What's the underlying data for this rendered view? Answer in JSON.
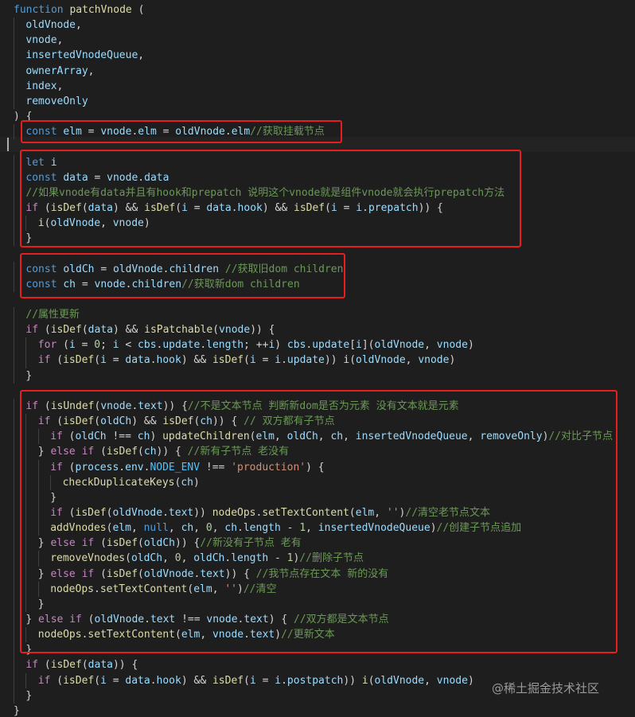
{
  "code_lines": [
    "function patchVnode (",
    "oldVnode,",
    "vnode,",
    "insertedVnodeQueue,",
    "ownerArray,",
    "index,",
    "removeOnly",
    ") {",
    "const elm = vnode.elm = oldVnode.elm//获取挂载节点",
    "",
    "let i",
    "const data = vnode.data",
    "//如果vnode有data并且有hook和prepatch 说明这个vnode就是组件vnode就会执行prepatch方法",
    "if (isDef(data) && isDef(i = data.hook) && isDef(i = i.prepatch)) {",
    "i(oldVnode, vnode)",
    "}",
    "",
    "const oldCh = oldVnode.children //获取旧dom children",
    "const ch = vnode.children//获取新dom children",
    "",
    "//属性更新",
    "if (isDef(data) && isPatchable(vnode)) {",
    "for (i = 0; i < cbs.update.length; ++i) cbs.update[i](oldVnode, vnode)",
    "if (isDef(i = data.hook) && isDef(i = i.update)) i(oldVnode, vnode)",
    "}",
    "",
    "if (isUndef(vnode.text)) {//不是文本节点 判断新dom是否为元素 没有文本就是元素",
    "if (isDef(oldCh) && isDef(ch)) { // 双方都有子节点",
    "if (oldCh !== ch) updateChildren(elm, oldCh, ch, insertedVnodeQueue, removeOnly)//对比子节点",
    "} else if (isDef(ch)) { //新有子节点 老没有",
    "if (process.env.NODE_ENV !== 'production') {",
    "checkDuplicateKeys(ch)",
    "}",
    "if (isDef(oldVnode.text)) nodeOps.setTextContent(elm, '')//清空老节点文本",
    "addVnodes(elm, null, ch, 0, ch.length - 1, insertedVnodeQueue)//创建子节点追加",
    "} else if (isDef(oldCh)) {//新没有子节点 老有",
    "removeVnodes(oldCh, 0, oldCh.length - 1)//删除子节点",
    "} else if (isDef(oldVnode.text)) { //我节点存在文本 新的没有",
    "nodeOps.setTextContent(elm, '')//清空",
    "}",
    "} else if (oldVnode.text !== vnode.text) { //双方都是文本节点",
    "nodeOps.setTextContent(elm, vnode.text)//更新文本",
    "}",
    "if (isDef(data)) {",
    "if (isDef(i = data.hook) && isDef(i = i.postpatch)) i(oldVnode, vnode)",
    "}",
    "}"
  ],
  "watermark": "@稀土掘金技术社区",
  "colors": {
    "background": "#1e1e1e",
    "keyword": "#569cd6",
    "control": "#c586c0",
    "function": "#dcdcaa",
    "variable": "#9cdcfe",
    "comment": "#6a9955",
    "string": "#ce9178",
    "number": "#b5cea8",
    "highlight_box": "#e81e1e"
  }
}
